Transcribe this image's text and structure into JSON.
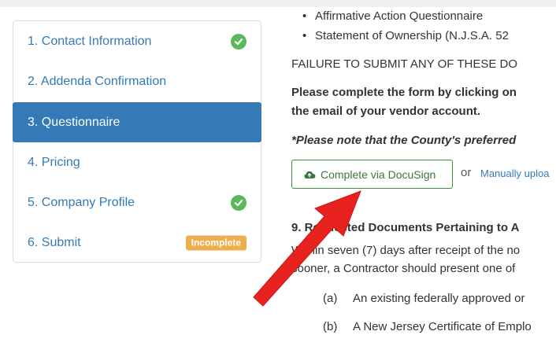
{
  "sidebar": {
    "steps": [
      {
        "label": "1. Contact Information",
        "status": "complete"
      },
      {
        "label": "2. Addenda Confirmation",
        "status": ""
      },
      {
        "label": "3. Questionnaire",
        "status": "active"
      },
      {
        "label": "4. Pricing",
        "status": ""
      },
      {
        "label": "5. Company Profile",
        "status": "complete"
      },
      {
        "label": "6. Submit",
        "status": "incomplete",
        "badge": "Incomplete"
      }
    ]
  },
  "content": {
    "bullets": [
      "Affirmative Action Questionnaire",
      "Statement of Ownership (N.J.S.A. 52"
    ],
    "failure_text": "FAILURE TO SUBMIT ANY OF THESE DO",
    "instruction_line1": "Please complete the form by clicking on",
    "instruction_line2": "the email of your vendor account.",
    "note": "*Please note that the County's preferred",
    "docusign_button": "Complete via DocuSign",
    "or_text": "or",
    "upload_link": "Manually uploa",
    "section_heading": "9. Requested Documents Pertaining to A",
    "section_line1": "Within seven (7) days after receipt of the no",
    "section_line2": "sooner, a Contractor should present one of",
    "items": [
      {
        "label": "(a)",
        "text": "An existing federally approved or"
      },
      {
        "label": "(b)",
        "text": "A New Jersey Certificate of Emplo"
      }
    ]
  },
  "colors": {
    "primary": "#337ab7",
    "success": "#5cb85c",
    "warning": "#f0ad4e",
    "annotation_arrow": "#e8231f"
  }
}
